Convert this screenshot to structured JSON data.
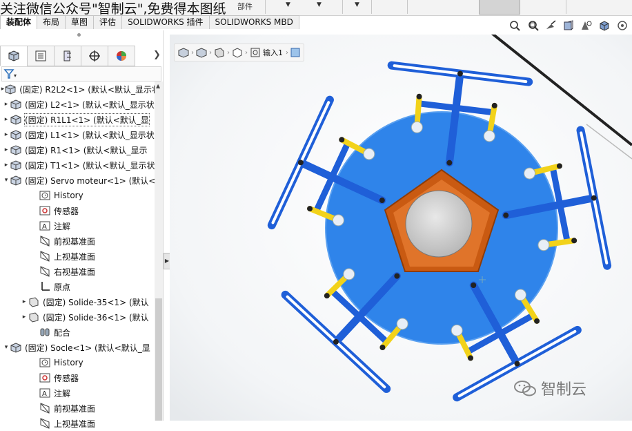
{
  "watermark_top": "关注微信公众号\"智制云\",免费得本图纸",
  "command": {
    "part_label": "部件"
  },
  "tabs": [
    {
      "label": "装配体"
    },
    {
      "label": "布局"
    },
    {
      "label": "草图"
    },
    {
      "label": "评估"
    },
    {
      "label": "SOLIDWORKS 插件"
    },
    {
      "label": "SOLIDWORKS MBD"
    }
  ],
  "view_toolbar": {
    "icons": [
      "zoom-to-fit-icon",
      "zoom-to-area-icon",
      "previous-view-icon",
      "section-view-icon",
      "view-orientation-icon",
      "display-style-icon",
      "more-icon"
    ]
  },
  "panel_tabs": [
    "featuremanager-icon",
    "propertymanager-icon",
    "configurationmanager-icon",
    "dimxpert-icon",
    "display-manager-icon"
  ],
  "tree": [
    {
      "label": "(固定) R2L2<1> (默认<默认_显示状",
      "kind": "component",
      "expand": "▸"
    },
    {
      "label": "(固定) L2<1> (默认<默认_显示状",
      "kind": "component",
      "expand": "▸"
    },
    {
      "label": "(固定) R1L1<1> (默认<默认_显",
      "kind": "component",
      "expand": "▸"
    },
    {
      "label": "(固定) L1<1> (默认<默认_显示状",
      "kind": "component",
      "expand": "▸"
    },
    {
      "label": "(固定) R1<1> (默认<默认_显示",
      "kind": "component",
      "expand": "▸"
    },
    {
      "label": "(固定) T1<1> (默认<默认_显示状",
      "kind": "component",
      "expand": "▸"
    },
    {
      "label": "(固定) Servo moteur<1> (默认<",
      "kind": "component",
      "expand": "▾"
    },
    {
      "label": "History",
      "kind": "history"
    },
    {
      "label": "传感器",
      "kind": "sensor"
    },
    {
      "label": "注解",
      "kind": "annotation"
    },
    {
      "label": "前视基准面",
      "kind": "plane"
    },
    {
      "label": "上视基准面",
      "kind": "plane"
    },
    {
      "label": "右视基准面",
      "kind": "plane"
    },
    {
      "label": "原点",
      "kind": "origin"
    },
    {
      "label": "(固定) Solide-35<1> (默认",
      "kind": "part",
      "expand": "▸"
    },
    {
      "label": "(固定) Solide-36<1> (默认",
      "kind": "part",
      "expand": "▸"
    },
    {
      "label": "配合",
      "kind": "mates"
    },
    {
      "label": "(固定) Socle<1> (默认<默认_显",
      "kind": "component",
      "expand": "▾"
    },
    {
      "label": "History",
      "kind": "history"
    },
    {
      "label": "传感器",
      "kind": "sensor"
    },
    {
      "label": "注解",
      "kind": "annotation"
    },
    {
      "label": "前视基准面",
      "kind": "plane"
    },
    {
      "label": "上视基准面",
      "kind": "plane"
    }
  ],
  "breadcrumb": {
    "input_label": "输入1"
  },
  "watermark_bottom": {
    "brand": "智制云"
  },
  "colors": {
    "arm_blue": "#1f5fd8",
    "disk_blue": "#2b7fe6",
    "hub_orange": "#d9661a",
    "link_yellow": "#f2d21a"
  }
}
